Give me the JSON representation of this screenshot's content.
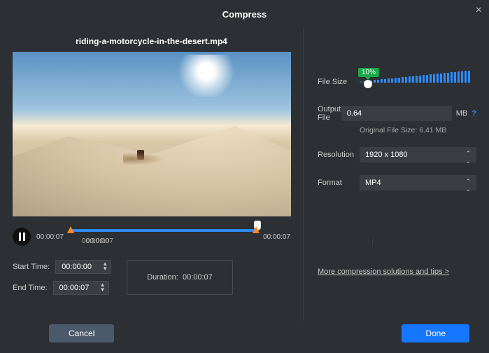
{
  "title": "Compress",
  "filename": "riding-a-motorcycle-in-the-desert.mp4",
  "timeline": {
    "current": "00:00:07",
    "end": "00:00:07",
    "range_start": "00:00:00",
    "range_end": "00:00:07"
  },
  "start_time": {
    "label": "Start Time:",
    "value": "00:00:00"
  },
  "end_time": {
    "label": "End Time:",
    "value": "00:00:07"
  },
  "duration": {
    "label": "Duration:",
    "value": "00:00:07"
  },
  "file_size": {
    "label": "File Size",
    "percent": "10%"
  },
  "output_file": {
    "label": "Output File",
    "value": "0.64",
    "unit": "MB"
  },
  "original_size_text": "Original File Size: 6.41 MB",
  "resolution": {
    "label": "Resolution",
    "value": "1920 x 1080"
  },
  "format": {
    "label": "Format",
    "value": "MP4"
  },
  "more_link": "More compression solutions and tips >",
  "buttons": {
    "cancel": "Cancel",
    "done": "Done"
  }
}
